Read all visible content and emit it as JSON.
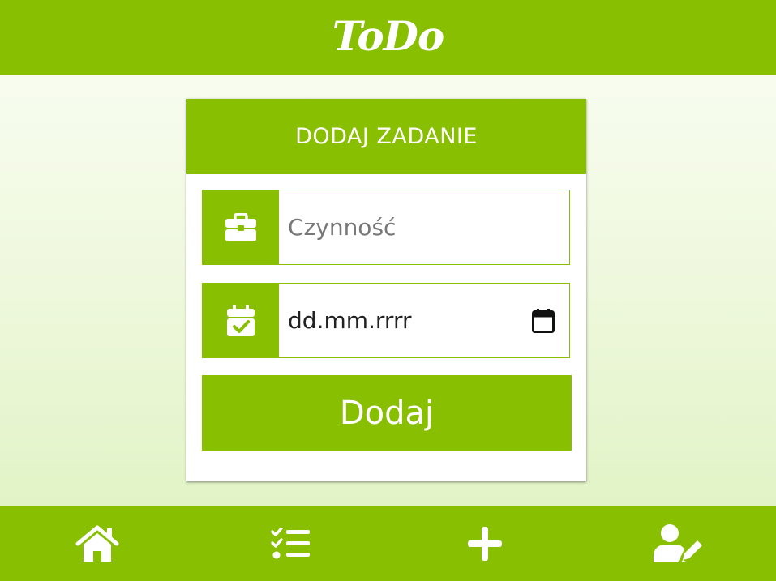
{
  "app": {
    "title": "ToDo"
  },
  "colors": {
    "accent": "#88bf00",
    "text_on_accent": "#ffffff",
    "background_top": "#fbfef6",
    "background_bottom": "#ddf2bf"
  },
  "form": {
    "title": "DODAJ ZADANIE",
    "task_field": {
      "icon": "briefcase-icon",
      "placeholder": "Czynność",
      "value": ""
    },
    "date_field": {
      "icon": "calendar-check-icon",
      "placeholder": "dd.mm.rrrr",
      "picker_icon": "calendar-icon"
    },
    "submit_label": "Dodaj"
  },
  "nav": {
    "items": [
      {
        "icon": "home-icon"
      },
      {
        "icon": "task-list-icon"
      },
      {
        "icon": "plus-icon"
      },
      {
        "icon": "user-edit-icon"
      }
    ]
  }
}
